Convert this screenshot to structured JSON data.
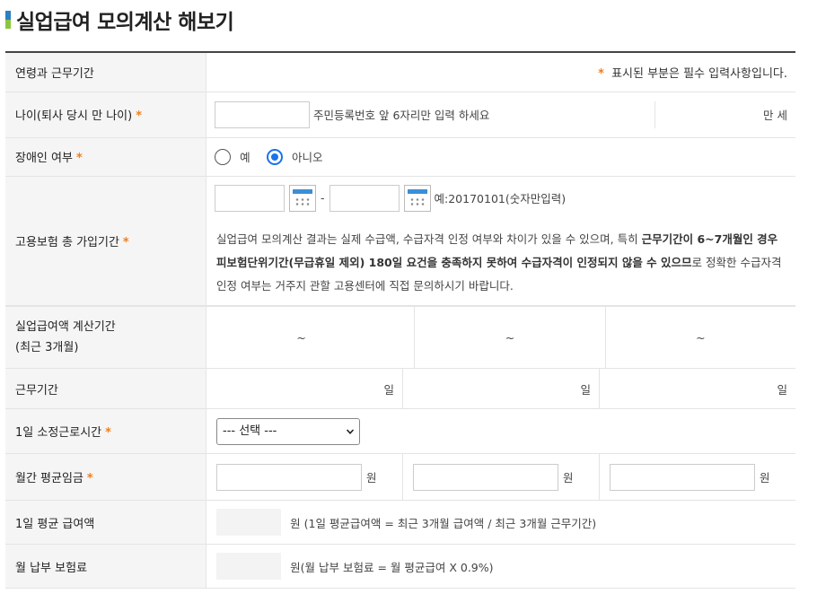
{
  "page": {
    "title": "실업급여 모의계산 해보기"
  },
  "section": {
    "header": "연령과 근무기간",
    "required_mark": "*",
    "required_note": "표시된 부분은 필수 입력사항입니다."
  },
  "age": {
    "label": "나이(퇴사 당시 만 나이)",
    "hint": "주민등록번호 앞 6자리만 입력 하세요",
    "unit": "만 세",
    "value": ""
  },
  "disabled": {
    "label": "장애인 여부",
    "yes": "예",
    "no": "아니오",
    "selected": "no"
  },
  "insurance": {
    "label": "고용보험 총 가입기간",
    "dash": "-",
    "example": "예:20170101(숫자만입력)",
    "note_part1": "실업급여 모의계산 결과는 실제 수급액, 수급자격 인정 여부와 차이가 있을 수 있으며, 특히 ",
    "note_bold": "근무기간이 6~7개월인 경우 피보험단위기간(무급휴일 제외) 180일 요건을 충족하지 못하여 수급자격이 인정되지 않을 수 있으므",
    "note_part2": "로 정확한 수급자격 인정 여부는 거주지 관할 고용센터에 직접 문의하시기 바랍니다."
  },
  "calc_period": {
    "label_line1": "실업급여액 계산기간",
    "label_line2": "(최근 3개월)",
    "sep": "~"
  },
  "work_period": {
    "label": "근무기간",
    "unit": "일"
  },
  "daily_hours": {
    "label": "1일 소정근로시간",
    "selected": "--- 선택 ---"
  },
  "monthly_wage": {
    "label": "월간 평균임금",
    "unit": "원"
  },
  "daily_avg": {
    "label": "1일 평균 급여액",
    "formula": "원 (1일 평균급여액 = 최근 3개월 급여액 / 최근 3개월 근무기간)"
  },
  "monthly_premium": {
    "label": "월 납부 보험료",
    "formula": "원(월 납부 보험료 = 월 평균급여 X 0.9%)"
  },
  "colors": {
    "accent": "#f07f19",
    "radio": "#1a73e8",
    "title_bar_blue": "#2d7fc1",
    "title_bar_green": "#8cc63f"
  },
  "icons": [
    "calendar-icon",
    "radio-button",
    "chevron-down-icon"
  ]
}
